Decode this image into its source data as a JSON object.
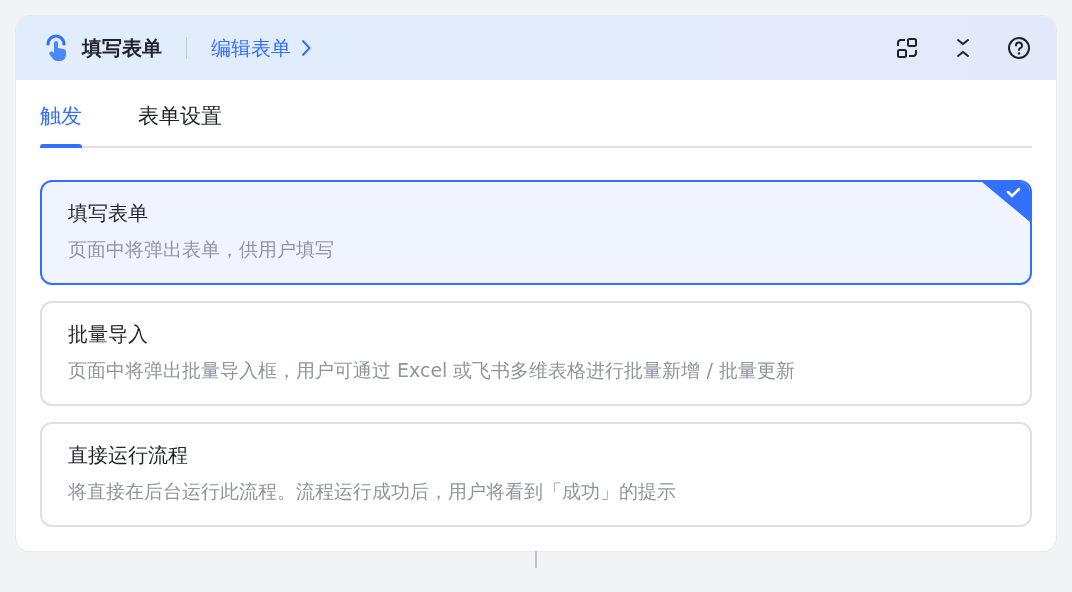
{
  "header": {
    "title": "填写表单",
    "link": "编辑表单"
  },
  "tabs": [
    {
      "label": "触发",
      "selected": true
    },
    {
      "label": "表单设置",
      "selected": false
    }
  ],
  "options": [
    {
      "title": "填写表单",
      "description": "页面中将弹出表单，供用户填写",
      "selected": true
    },
    {
      "title": "批量导入",
      "description": "页面中将弹出批量导入框，用户可通过 Excel 或飞书多维表格进行批量新增 / 批量更新",
      "selected": false
    },
    {
      "title": "直接运行流程",
      "description": "将直接在后台运行此流程。流程运行成功后，用户将看到「成功」的提示",
      "selected": false
    }
  ]
}
